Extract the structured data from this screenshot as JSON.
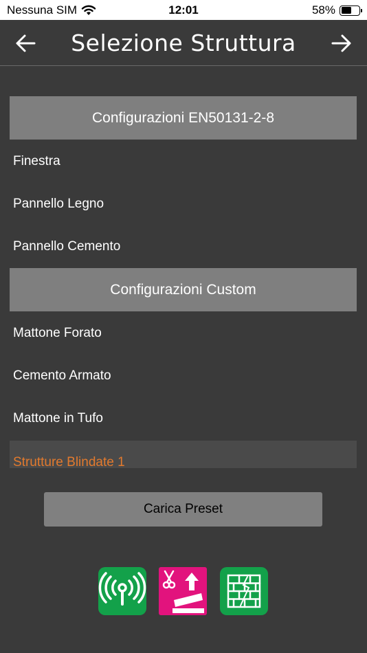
{
  "status_bar": {
    "carrier": "Nessuna SIM",
    "time": "12:01",
    "battery_percent": "58%",
    "battery_level": 0.58
  },
  "nav": {
    "title": "Selezione Struttura",
    "back_icon": "arrow-left-icon",
    "forward_icon": "arrow-right-icon"
  },
  "sections": [
    {
      "header": "Configurazioni EN50131-2-8",
      "items": [
        "Finestra",
        "Pannello Legno",
        "Pannello Cemento"
      ]
    },
    {
      "header": "Configurazioni Custom",
      "items": [
        "Mattone Forato",
        "Cemento Armato",
        "Mattone in Tufo",
        "Strutture Blindate 1"
      ]
    }
  ],
  "selected_item": "Strutture Blindate 1",
  "preset_button": "Carica Preset",
  "bottom_icons": [
    "antenna-signal-icon",
    "cut-and-lift-icon",
    "brick-wall-icon"
  ],
  "colors": {
    "background": "#3a3a3a",
    "header_bg": "#7f7f7f",
    "selected_text": "#e27a2e",
    "icon_green": "#13a14a",
    "icon_pink": "#e2137d"
  }
}
